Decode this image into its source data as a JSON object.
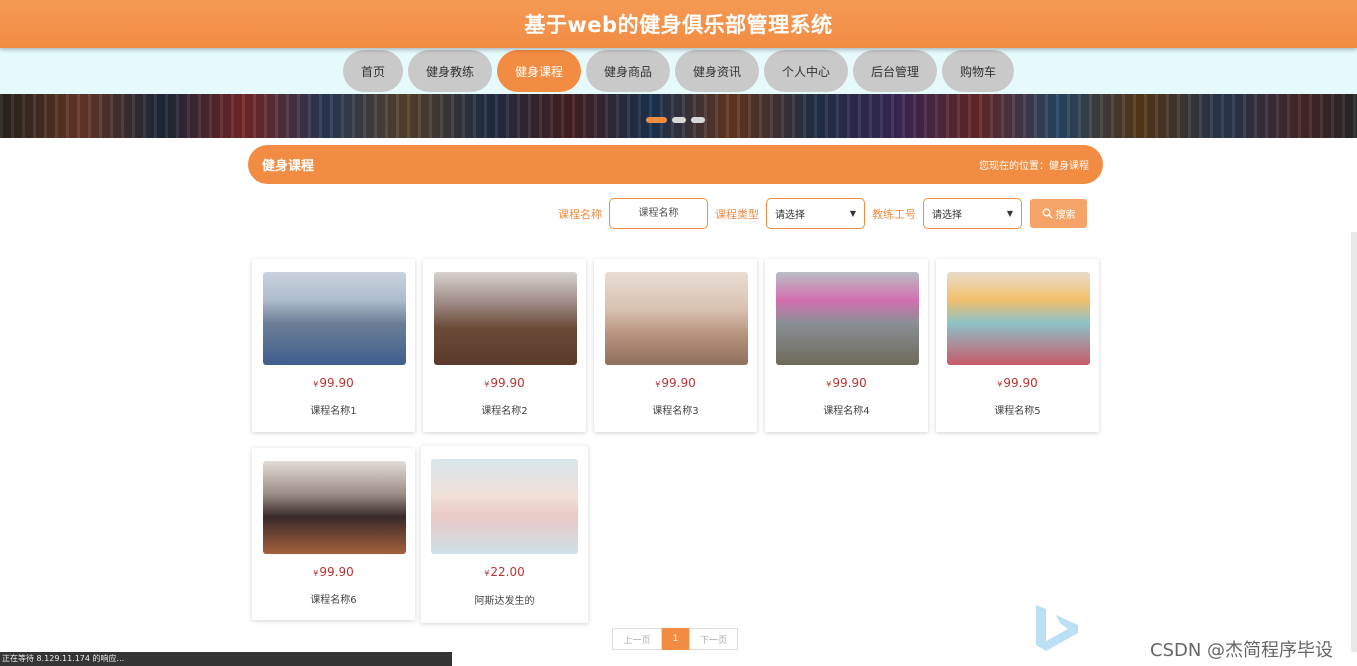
{
  "header": {
    "title": "基于web的健身俱乐部管理系统"
  },
  "nav": {
    "items": [
      {
        "label": "首页",
        "active": false
      },
      {
        "label": "健身教练",
        "active": false
      },
      {
        "label": "健身课程",
        "active": true
      },
      {
        "label": "健身商品",
        "active": false
      },
      {
        "label": "健身资讯",
        "active": false
      },
      {
        "label": "个人中心",
        "active": false
      },
      {
        "label": "后台管理",
        "active": false
      },
      {
        "label": "购物车",
        "active": false
      }
    ]
  },
  "carousel": {
    "slide_count": 3,
    "active_index": 0
  },
  "section": {
    "title": "健身课程",
    "breadcrumb": "您现在的位置：健身课程"
  },
  "search": {
    "name_label": "课程名称",
    "name_placeholder": "课程名称",
    "type_label": "课程类型",
    "type_selected": "请选择",
    "coach_label": "教练工号",
    "coach_selected": "请选择",
    "button_label": "搜索",
    "button_icon": "search-icon"
  },
  "products": [
    {
      "price": "99.90",
      "name": "课程名称1"
    },
    {
      "price": "99.90",
      "name": "课程名称2"
    },
    {
      "price": "99.90",
      "name": "课程名称3"
    },
    {
      "price": "99.90",
      "name": "课程名称4"
    },
    {
      "price": "99.90",
      "name": "课程名称5"
    },
    {
      "price": "99.90",
      "name": "课程名称6"
    },
    {
      "price": "22.00",
      "name": "阿斯达发生的"
    }
  ],
  "currency": "¥",
  "pagination": {
    "prev": "上一页",
    "current": "1",
    "next": "下一页"
  },
  "status_bar": {
    "text": "正在等待 8.129.11.174 的响应..."
  },
  "watermark": {
    "text": "CSDN @杰简程序毕设"
  },
  "colors": {
    "accent": "#f28c43",
    "nav_bg": "#e6fafc",
    "nav_item": "#c9c9c9",
    "price": "#bb3333"
  }
}
